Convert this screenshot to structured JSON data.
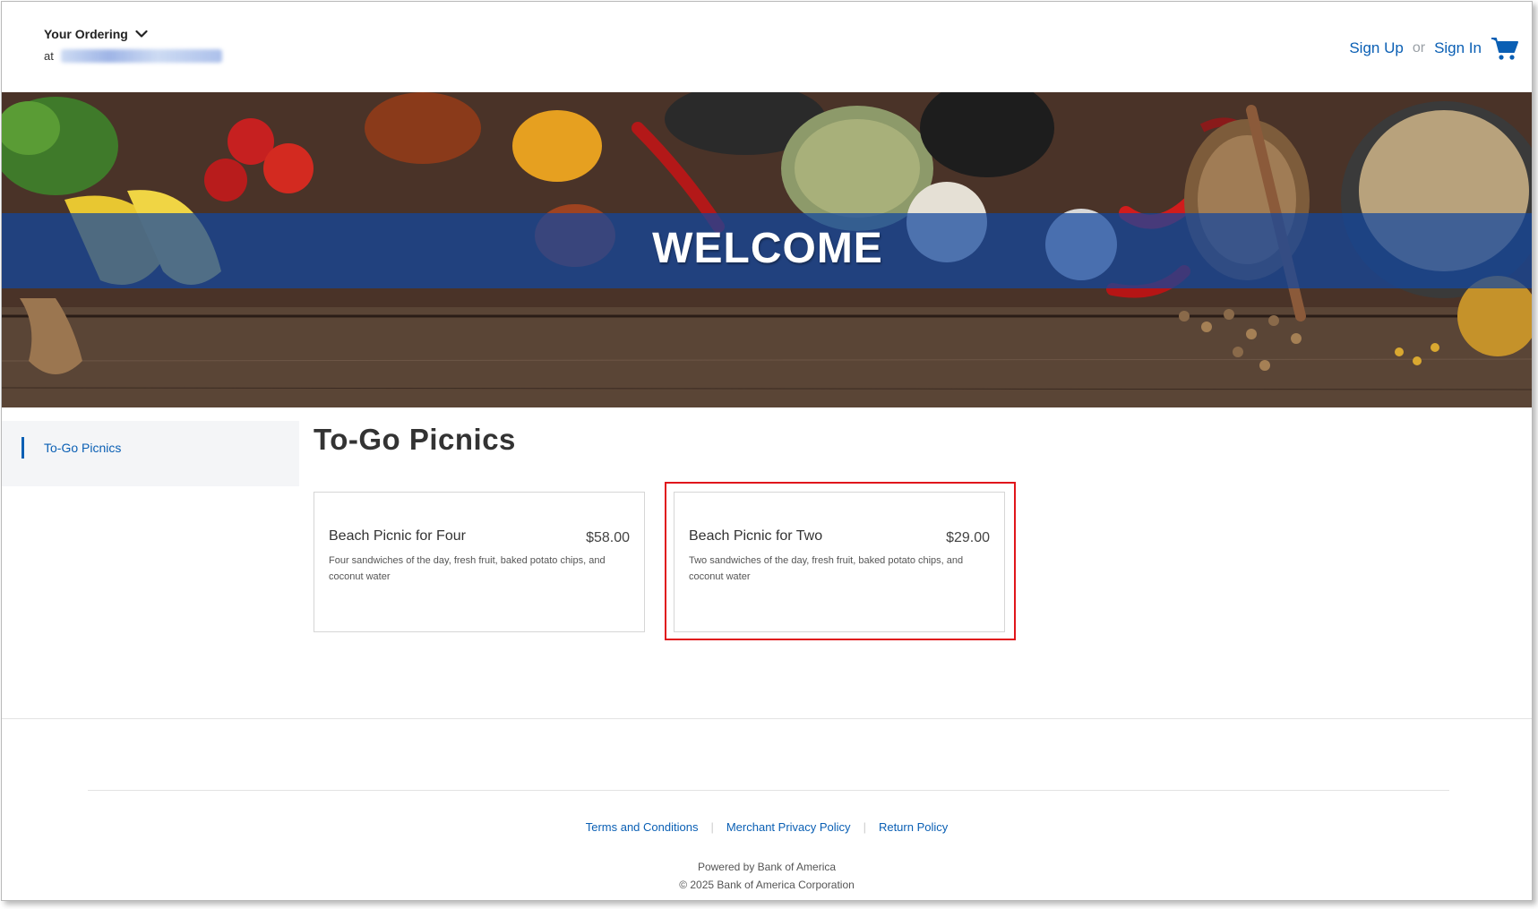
{
  "header": {
    "ordering_label": "Your Ordering",
    "at_label": "at",
    "sign_up": "Sign Up",
    "or_label": "or",
    "sign_in": "Sign In"
  },
  "hero": {
    "title": "WELCOME"
  },
  "sidebar": {
    "items": [
      {
        "label": "To-Go Picnics"
      }
    ]
  },
  "main": {
    "title": "To-Go Picnics",
    "items": [
      {
        "name": "Beach Picnic for Four",
        "price": "$58.00",
        "description": "Four sandwiches of the day, fresh fruit, baked potato chips, and coconut water"
      },
      {
        "name": "Beach Picnic for Two",
        "price": "$29.00",
        "description": "Two sandwiches of the day, fresh fruit, baked potato chips, and coconut water"
      }
    ]
  },
  "footer": {
    "links": [
      "Terms and Conditions",
      "Merchant Privacy Policy",
      "Return Policy"
    ],
    "powered_by": "Powered by Bank of America",
    "copyright": "© 2025 Bank of America Corporation"
  },
  "colors": {
    "link_blue": "#0a5fb4",
    "hero_band": "#1246a0",
    "highlight_red": "#e0161b"
  },
  "icons": [
    "chevron-down-icon",
    "cart-icon"
  ]
}
